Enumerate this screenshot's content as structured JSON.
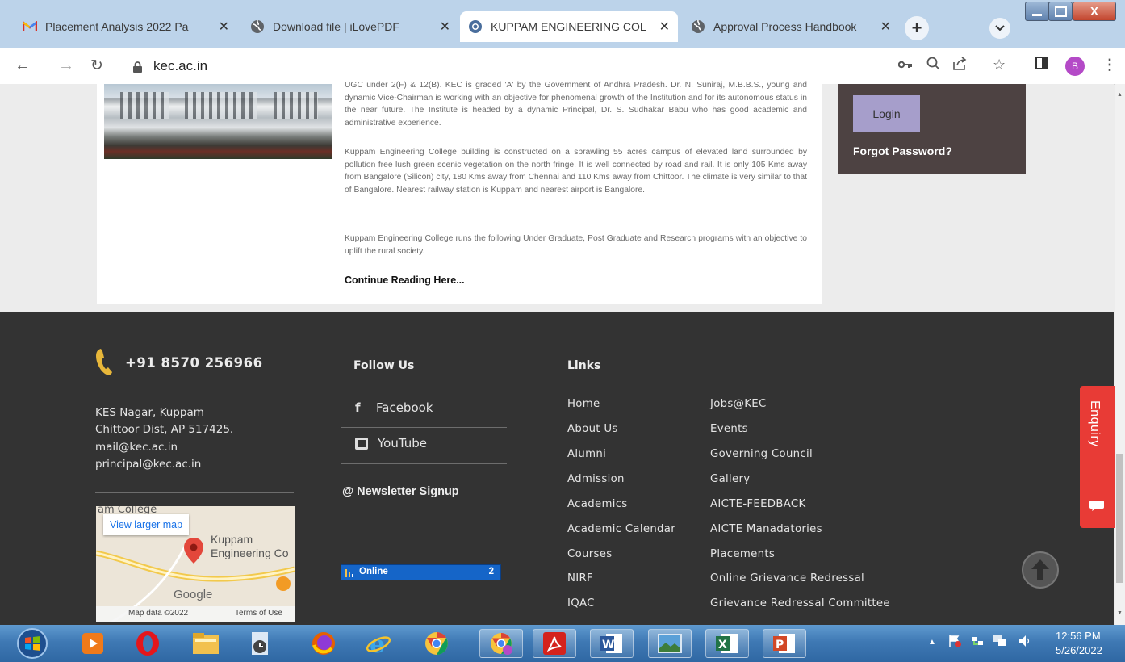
{
  "browser": {
    "tabs": [
      {
        "title": "Placement Analysis 2022 Pa",
        "icon": "gmail-icon",
        "close": "✕"
      },
      {
        "title": "Download file | iLovePDF",
        "icon": "globe-icon",
        "close": "✕"
      },
      {
        "title": "KUPPAM ENGINEERING COL",
        "icon": "chrome-tab-icon",
        "close": "✕"
      },
      {
        "title": "Approval Process Handbook",
        "icon": "globe-icon",
        "close": "✕"
      }
    ],
    "new_tab": "+",
    "url": "kec.ac.in",
    "profile_initial": "B"
  },
  "about": {
    "paragraph1": "UGC under 2(F) & 12(B). KEC is graded 'A' by the Government of Andhra Pradesh. Dr. N. Suniraj, M.B.B.S., young and dynamic Vice-Chairman is working with an objective for phenomenal growth of the Institution and for its autonomous status in the near future. The Institute is headed by a dynamic Principal, Dr. S. Sudhakar Babu who has good academic and administrative experience.",
    "paragraph2": "Kuppam Engineering College building is constructed on a sprawling 55 acres campus of elevated land surrounded by pollution free lush green scenic vegetation on the north fringe. It is well connected by road and rail. It is only 105 Kms away from Bangalore (Silicon) city, 180 Kms away from Chennai and 110 Kms away from Chittoor. The climate is very similar to that of Bangalore. Nearest railway station is Kuppam and nearest airport is Bangalore.",
    "paragraph3": "Kuppam Engineering College runs the following Under Graduate, Post Graduate and Research programs with an objective to uplift the rural society.",
    "continue": "Continue Reading Here..."
  },
  "login": {
    "button": "Login",
    "forgot": "Forgot Password?"
  },
  "footer": {
    "phone": "+91 8570 256966",
    "address": [
      "KES Nagar, Kuppam",
      "Chittoor Dist, AP 517425.",
      "mail@kec.ac.in",
      "principal@kec.ac.in"
    ],
    "map": {
      "place_partial": "am College",
      "view_larger": "View larger map",
      "pin_label_1": "Kuppam",
      "pin_label_2": "Engineering Co",
      "google": "Google",
      "map_data": "Map data ©2022",
      "terms": "Terms of Use"
    },
    "follow_title": "Follow Us",
    "facebook": "Facebook",
    "facebook_glyph": "f",
    "youtube": "YouTube",
    "newsletter": "@ Newsletter Signup",
    "online_label": "Online",
    "online_count": "2",
    "links_title": "Links",
    "links_left": [
      "Home",
      "About Us",
      "Alumni",
      "Admission",
      "Academics",
      "Academic Calendar",
      "Courses",
      "NIRF",
      "IQAC"
    ],
    "links_right": [
      "Jobs@KEC",
      "Events",
      "Governing Council",
      "Gallery",
      "AICTE-FEEDBACK",
      "AICTE Manadatories",
      "Placements",
      "Online Grievance Redressal",
      "Grievance Redressal Committee"
    ],
    "enquiry": "Enquiry"
  },
  "taskbar": {
    "time": "12:56 PM",
    "date": "5/26/2022"
  },
  "colors": {
    "footer_bg": "#333333",
    "login_panel": "#4d4242",
    "login_button": "#a69ecb",
    "enquiry": "#e83b36",
    "tabbar": "#bcd3ea"
  }
}
